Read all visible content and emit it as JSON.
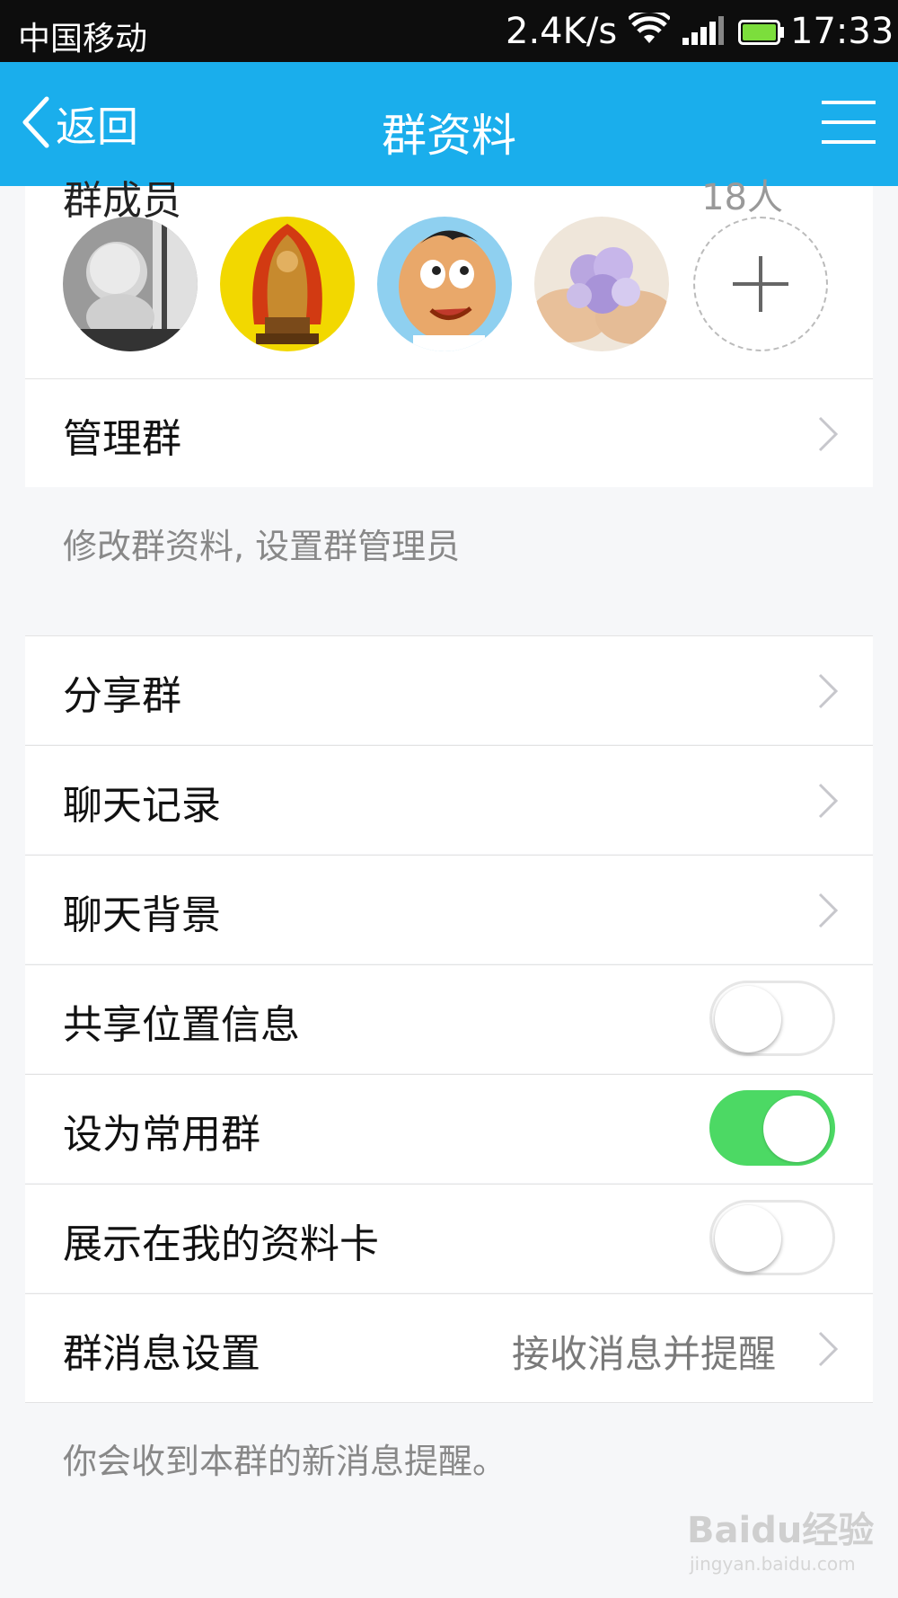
{
  "status_bar": {
    "carrier": "中国移动",
    "net_speed": "2.4K/s",
    "time": "17:33",
    "battery_color": "#7cde3c"
  },
  "nav": {
    "back_label": "返回",
    "title": "群资料",
    "color": "#1aaeec"
  },
  "members": {
    "header": "群成员",
    "count": "18人",
    "avatars": [
      "baby-avatar",
      "buddha-avatar",
      "cartoon-boy-avatar",
      "flowers-avatar"
    ],
    "add_icon": "plus-icon"
  },
  "manage": {
    "label": "管理群",
    "hint": "修改群资料, 设置群管理员"
  },
  "rows": {
    "share": "分享群",
    "history": "聊天记录",
    "background": "聊天背景",
    "share_location": "共享位置信息",
    "set_frequent": "设为常用群",
    "show_on_card": "展示在我的资料卡",
    "msg_settings": "群消息设置"
  },
  "toggles": {
    "share_location": false,
    "set_frequent": true,
    "show_on_card": false,
    "on_color": "#4cd964"
  },
  "msg_settings_value": "接收消息并提醒",
  "msg_hint": "你会收到本群的新消息提醒。",
  "watermark": {
    "brand": "Baidu经验",
    "url": "jingyan.baidu.com"
  }
}
